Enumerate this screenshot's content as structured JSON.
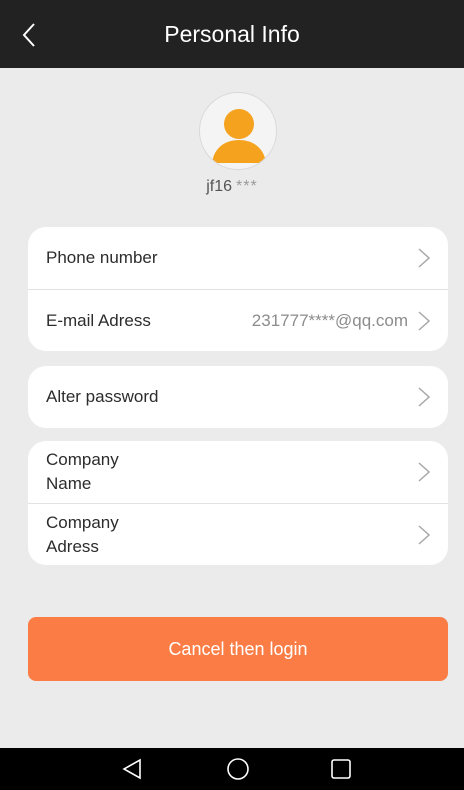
{
  "header": {
    "title": "Personal Info",
    "back_icon": "chevron-left-icon"
  },
  "profile": {
    "avatar_icon": "user-avatar-icon",
    "username": "jf16",
    "username_mask": "***"
  },
  "groups": [
    {
      "rows": [
        {
          "label": "Phone number",
          "value": ""
        },
        {
          "label": "E-mail Adress",
          "value": "231777****@qq.com"
        }
      ]
    },
    {
      "rows": [
        {
          "label": "Alter password",
          "value": ""
        }
      ]
    },
    {
      "rows": [
        {
          "label": "Company Name",
          "value": ""
        },
        {
          "label": "Company Adress",
          "value": ""
        }
      ]
    }
  ],
  "actions": {
    "logout_label": "Cancel then login"
  },
  "nav": {
    "back": "triangle-back-icon",
    "home": "circle-home-icon",
    "recent": "square-recent-icon"
  },
  "colors": {
    "topbar": "#222222",
    "background": "#ebebeb",
    "accent": "#fb7d45",
    "avatar": "#f5a21f"
  }
}
